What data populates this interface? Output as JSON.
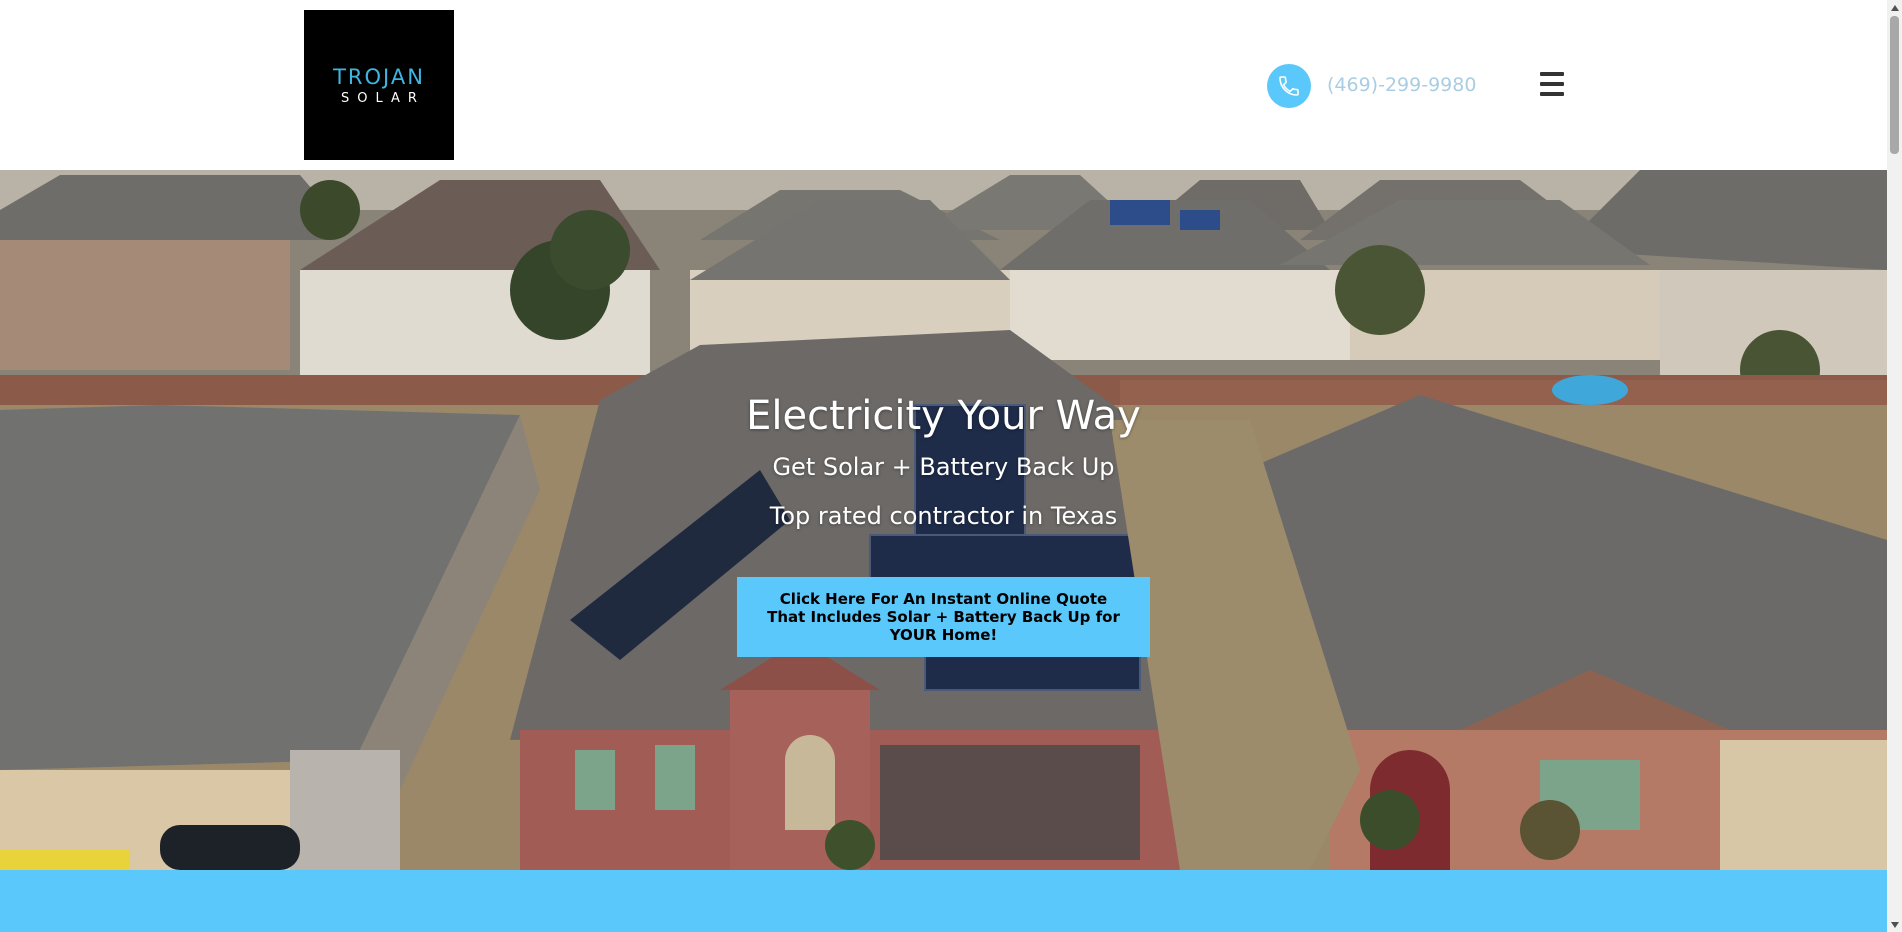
{
  "header": {
    "logo": {
      "line1": "TROJAN",
      "line2": "SOLAR",
      "icon": "sun-icon"
    },
    "phone": {
      "icon": "phone-icon",
      "number": "(469)-299-9980"
    },
    "menu_icon": "hamburger-menu-icon"
  },
  "hero": {
    "title": "Electricity Your Way",
    "subtitle_1": "Get Solar + Battery Back Up",
    "subtitle_2": "Top rated contractor in Texas",
    "cta_label": "Click Here For An Instant Online Quote That Includes Solar + Battery Back Up for YOUR Home!"
  },
  "colors": {
    "accent": "#5ac8fa",
    "logo_bg": "#000000",
    "logo_text": "#3fb6e0",
    "phone_text": "#a9cde3",
    "cta_text": "#000000"
  }
}
